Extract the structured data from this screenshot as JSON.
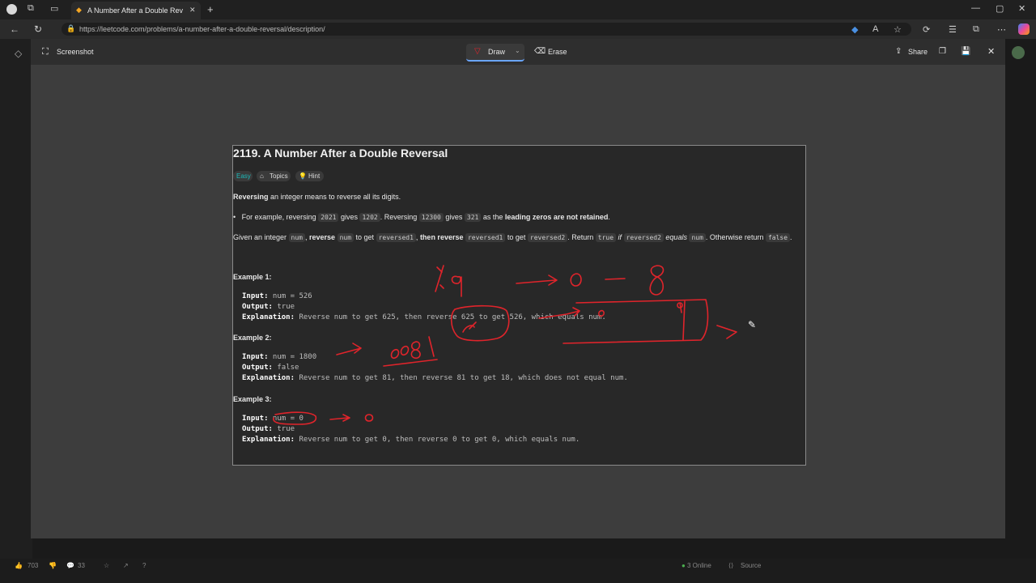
{
  "browser": {
    "tab_title": "A Number After a Double Reversal",
    "url": "https://leetcode.com/problems/a-number-after-a-double-reversal/description/"
  },
  "overlay": {
    "title": "Screenshot",
    "draw_label": "Draw",
    "erase_label": "Erase",
    "share_label": "Share"
  },
  "problem": {
    "title": "2119. A Number After a Double Reversal",
    "difficulty": "Easy",
    "topics_label": "Topics",
    "hint_label": "Hint",
    "intro_bold": "Reversing",
    "intro_rest": " an integer means to reverse all its digits.",
    "bullet": {
      "p1": "For example, reversing ",
      "c1": "2021",
      "p2": " gives ",
      "c2": "1202",
      "p3": ". Reversing ",
      "c3": "12300",
      "p4": " gives ",
      "c4": "321",
      "p5": " as the ",
      "bold": "leading zeros are not retained",
      "p6": "."
    },
    "given": {
      "p1": "Given an integer ",
      "c1": "num",
      "p2": ", ",
      "b1": "reverse",
      "p3": " ",
      "c2": "num",
      "p4": " to get ",
      "c3": "reversed1",
      "p5": ", ",
      "b2": "then reverse",
      "p6": " ",
      "c4": "reversed1",
      "p7": " to get ",
      "c5": "reversed2",
      "p8": ". Return ",
      "c6": "true",
      "p9": " ",
      "i1": "if",
      "p10": " ",
      "c7": "reversed2",
      "p11": " ",
      "i2": "equals",
      "p12": " ",
      "c8": "num",
      "p13": ". Otherwise return ",
      "c9": "false",
      "p14": "."
    },
    "examples": [
      {
        "heading": "Example 1:",
        "input_label": "Input:",
        "input": " num = 526",
        "output_label": "Output:",
        "output": " true",
        "expl_label": "Explanation:",
        "expl": " Reverse num to get 625, then reverse 625 to get 526, which equals num."
      },
      {
        "heading": "Example 2:",
        "input_label": "Input:",
        "input": " num = 1800",
        "output_label": "Output:",
        "output": " false",
        "expl_label": "Explanation:",
        "expl": " Reverse num to get 81, then reverse 81 to get 18, which does not equal num."
      },
      {
        "heading": "Example 3:",
        "input_label": "Input:",
        "input": " num = 0",
        "output_label": "Output:",
        "output": " true",
        "expl_label": "Explanation:",
        "expl": " Reverse num to get 0, then reverse 0 to get 0, which equals num."
      }
    ]
  },
  "background": {
    "likes": "703",
    "comments": "33",
    "online": "3 Online",
    "source": "Source"
  },
  "colors": {
    "ink": "#e0242b",
    "easy": "#1cbaba",
    "accent": "#6aa6ff"
  }
}
